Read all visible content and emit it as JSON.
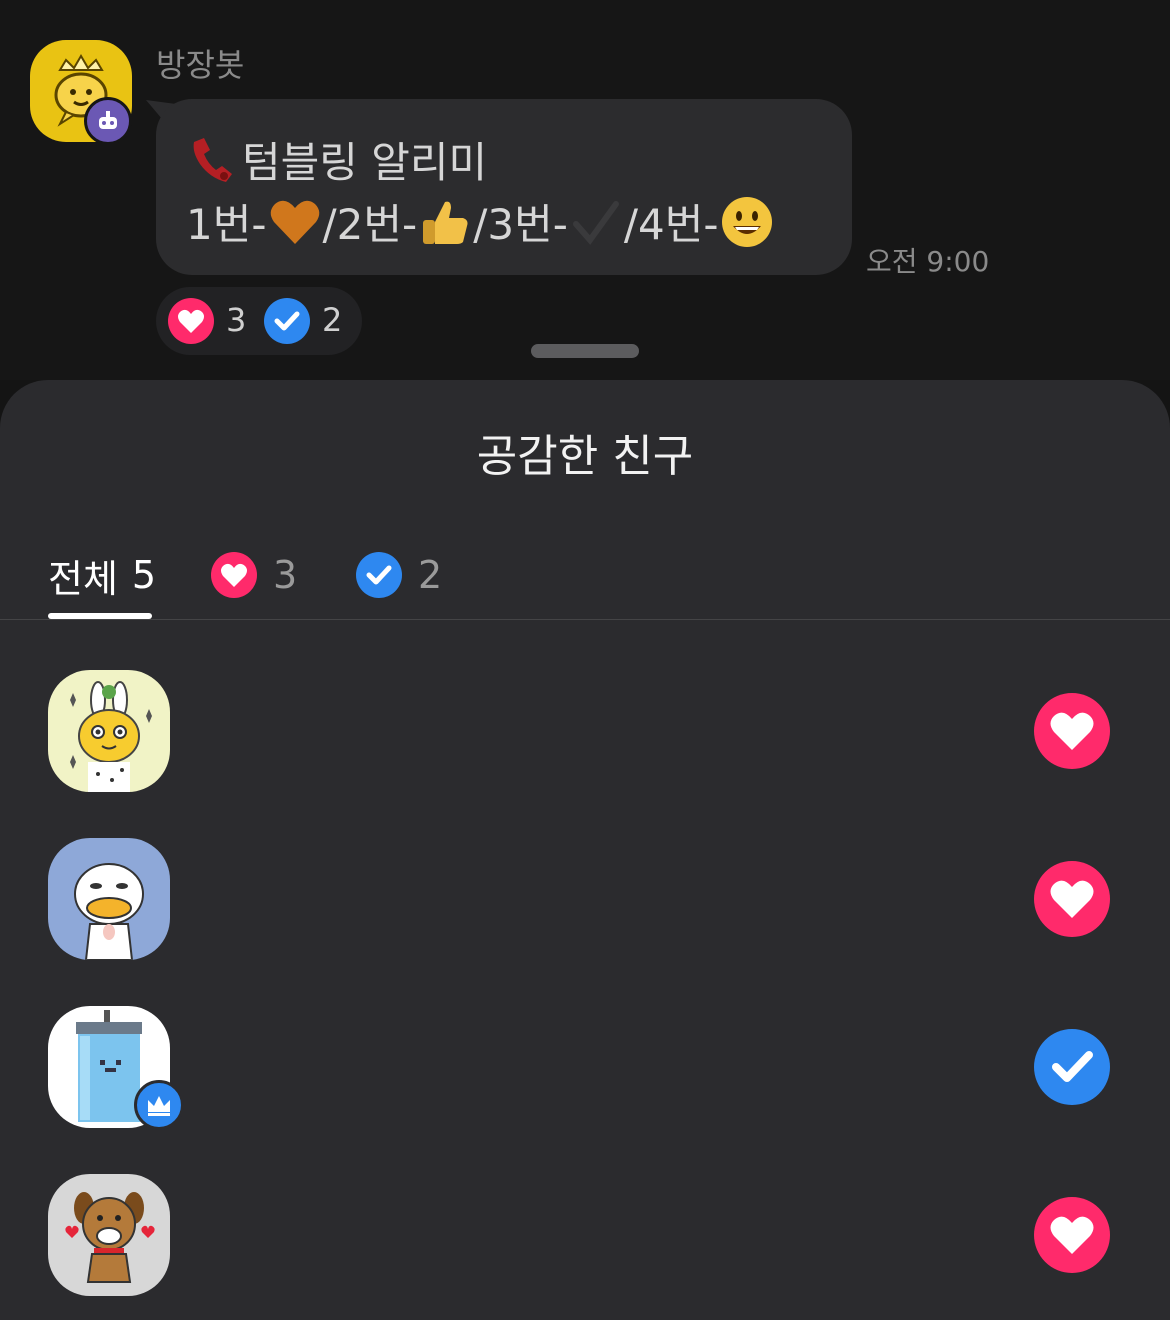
{
  "message": {
    "sender": "방장봇",
    "line1_text": "텀블링 알리미",
    "line2": [
      "1번-",
      "/2번-",
      "/3번-",
      "/4번-"
    ],
    "time": "오전 9:00",
    "reactions": [
      {
        "icon": "heart-icon",
        "count": "3"
      },
      {
        "icon": "check-icon",
        "count": "2"
      }
    ]
  },
  "sheet": {
    "title": "공감한 친구",
    "tabs": [
      {
        "label": "전체",
        "count": "5",
        "active": true
      },
      {
        "icon": "heart-icon",
        "count": "3"
      },
      {
        "icon": "check-icon",
        "count": "2"
      }
    ],
    "friends": [
      {
        "avatar": "rabbit-hood-character-avatar",
        "reaction": "heart"
      },
      {
        "avatar": "duck-character-avatar",
        "reaction": "heart"
      },
      {
        "avatar": "blue-tumbler-character-avatar",
        "reaction": "check",
        "badge": "crown-icon"
      },
      {
        "avatar": "brown-dog-character-avatar",
        "reaction": "heart"
      }
    ]
  },
  "colors": {
    "heart": "#ff2a6b",
    "check": "#2e88f0",
    "bubble": "#2c2c2e",
    "sheet": "#2b2b2e"
  }
}
